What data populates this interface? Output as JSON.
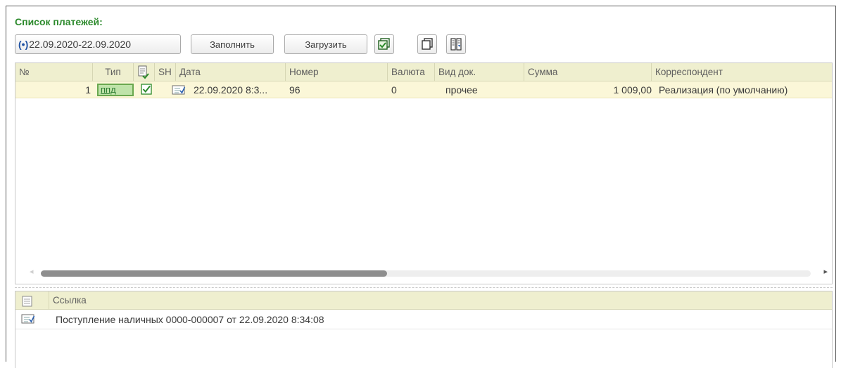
{
  "header": {
    "title": "Список платежей:"
  },
  "toolbar": {
    "period_icon": "(•)",
    "period_label": "22.09.2020-22.09.2020",
    "fill_label": "Заполнить",
    "load_label": "Загрузить",
    "icons": [
      "select-all-icon",
      "copy-icon",
      "columns-settings-icon"
    ]
  },
  "payments_table": {
    "columns": [
      "№",
      "Тип",
      "",
      "SH",
      "Дата",
      "Номер",
      "Валюта",
      "Вид док.",
      "Сумма",
      "Корреспондент"
    ],
    "rows": [
      {
        "num": "1",
        "type": "ппд",
        "checked": true,
        "date": "22.09.2020 8:3...",
        "number": "96",
        "currency": "0",
        "doc_kind": "прочее",
        "amount": "1 009,00",
        "correspondent": "Реализация (по умолчанию)"
      }
    ],
    "scroll_fraction": 0.45
  },
  "links_table": {
    "column": "Ссылка",
    "rows": [
      {
        "text": "Поступление наличных 0000-000007 от 22.09.2020 8:34:08"
      }
    ]
  },
  "colors": {
    "accent_green": "#2c8a2c",
    "header_bg": "#efefcf",
    "selected_row_bg": "#fbf7d8"
  }
}
